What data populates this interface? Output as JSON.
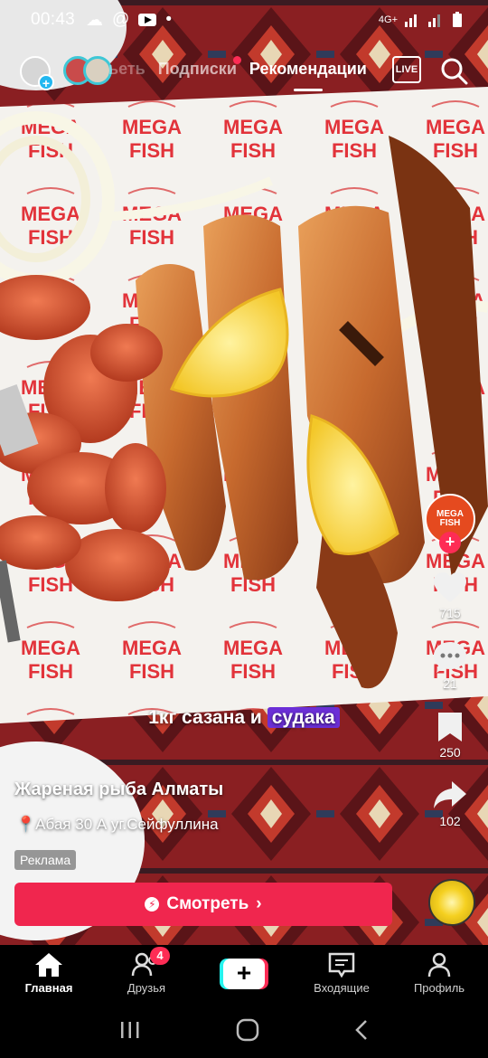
{
  "status_bar": {
    "time": "00:43",
    "network": "4G+"
  },
  "top_tabs": {
    "partial_tab": "ьеть",
    "following": "Подписки",
    "for_you": "Рекомендации",
    "live": "LIVE"
  },
  "video": {
    "brand_text_line1": "MEGA",
    "brand_text_line2": "FISH",
    "overlay_caption_plain": "1кг сазана и",
    "overlay_caption_highlight": "судака",
    "colors": {
      "highlight": "#6b2fd6",
      "cta": "#f0264e",
      "accent_red": "#fe2c55"
    }
  },
  "post": {
    "author": "Жареная рыба Алматы",
    "location": "Абая 30 А уг.Сейфуллина",
    "ad_label": "Реклама",
    "cta_label": "Смотреть"
  },
  "actions": {
    "creator_logo_line1": "MEGA",
    "creator_logo_line2": "FISH",
    "likes": "715",
    "comments": "21",
    "saves": "250",
    "shares": "102"
  },
  "bottom_nav": {
    "home": "Главная",
    "friends": "Друзья",
    "friends_badge": "4",
    "create": "+",
    "inbox": "Входящие",
    "profile": "Профиль"
  }
}
